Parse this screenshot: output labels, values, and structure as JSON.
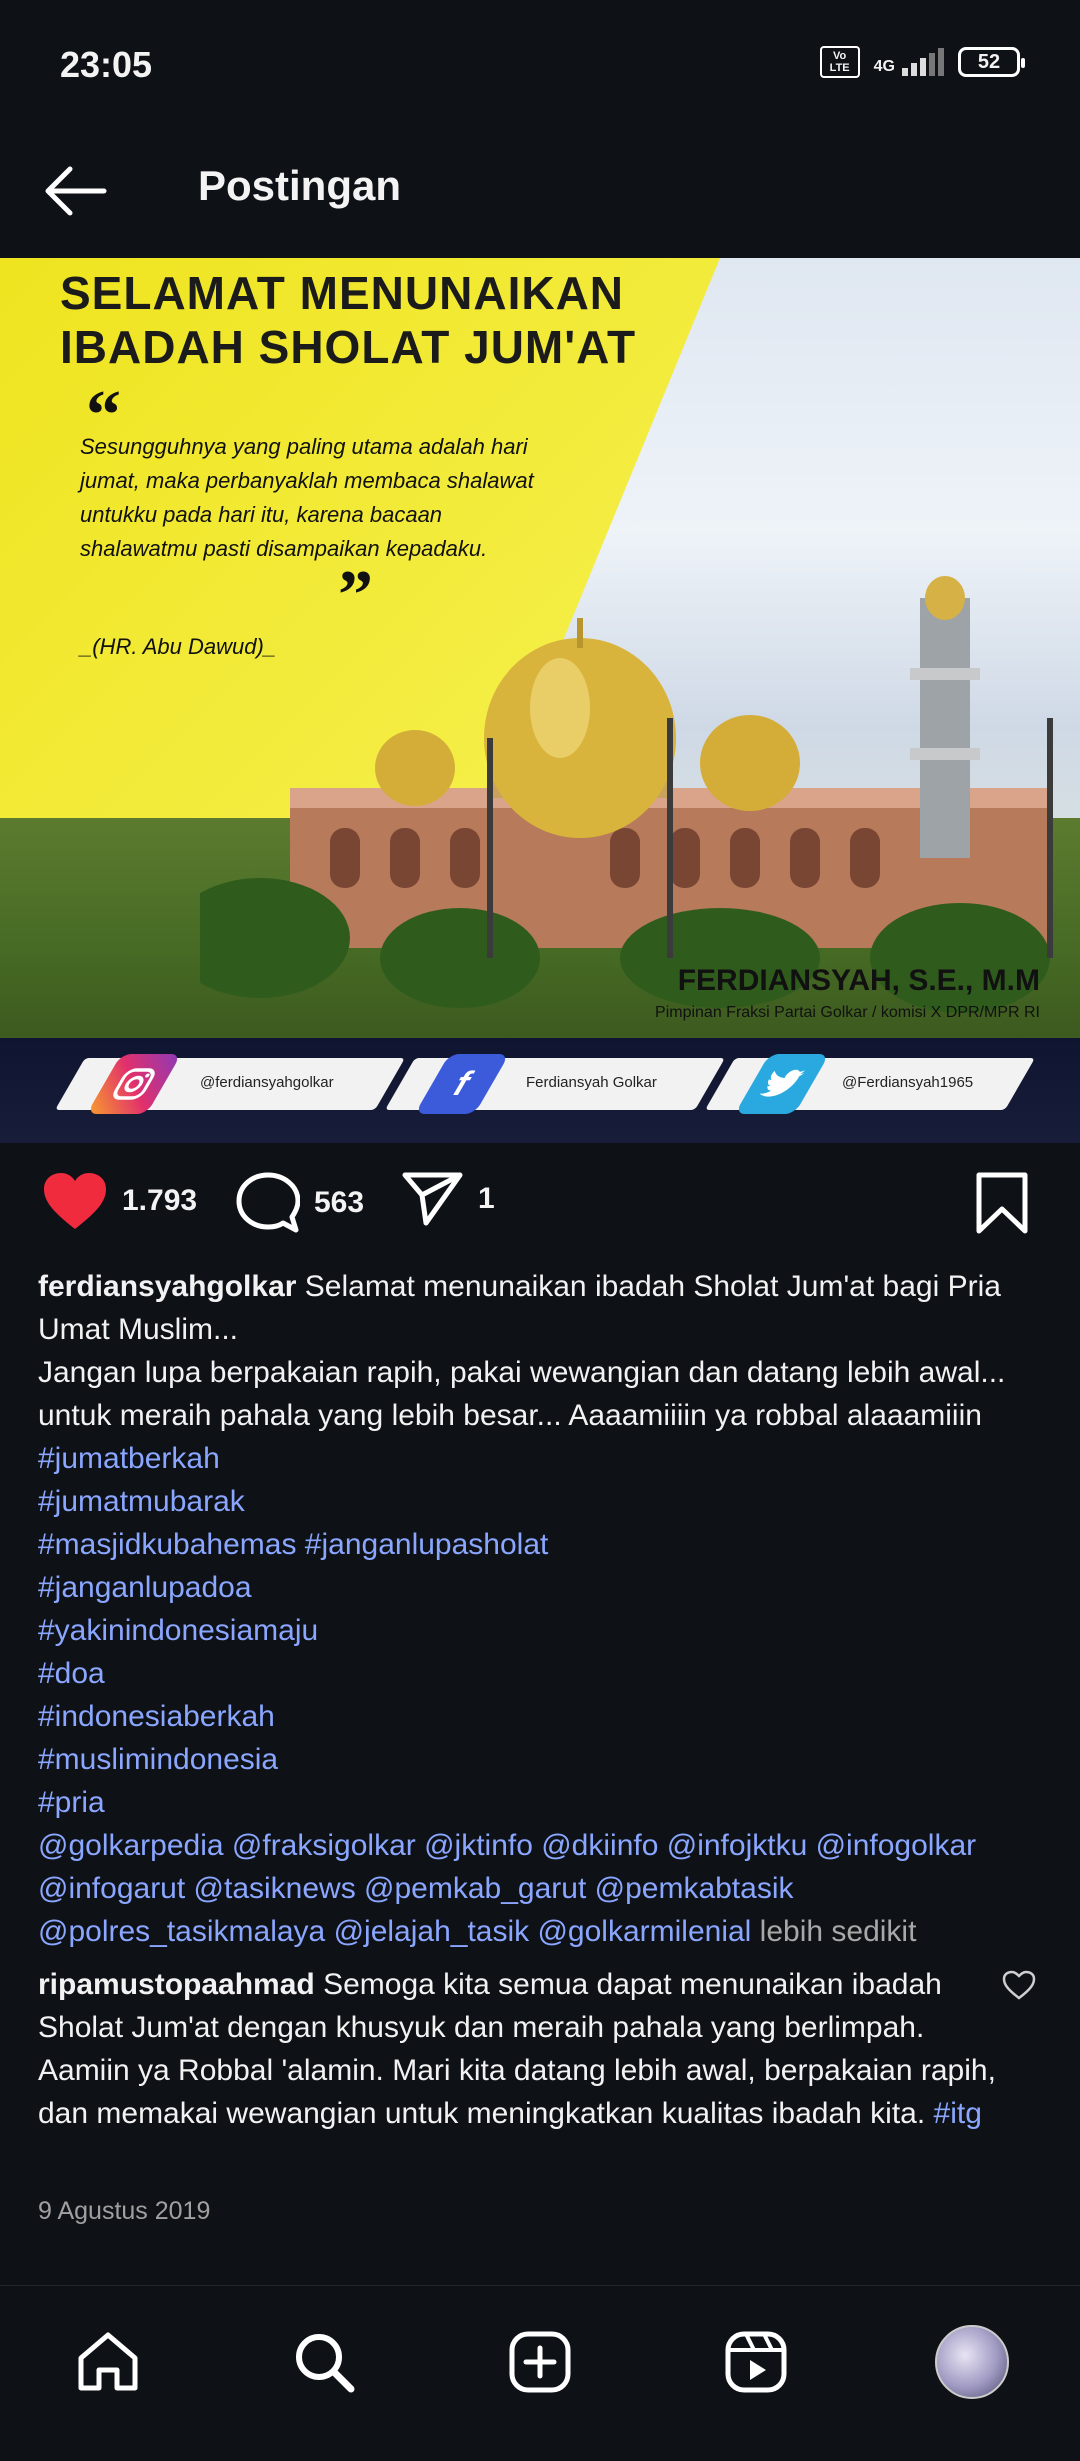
{
  "status_bar": {
    "time": "23:05",
    "volte": "Vo LTE",
    "network": "4G",
    "battery": "52"
  },
  "header": {
    "title": "Postingan"
  },
  "post_image": {
    "headline_line1": "SELAMAT MENUNAIKAN",
    "headline_line2": "IBADAH SHOLAT JUM'AT",
    "quote": "Sesungguhnya yang paling utama adalah hari jumat, maka perbanyaklah membaca shalawat untukku pada hari itu, karena bacaan shalawatmu pasti disampaikan kepadaku.",
    "quote_source": "_(HR. Abu Dawud)_",
    "signature_name": "FERDIANSYAH, S.E., M.M",
    "signature_sub": "Pimpinan Fraksi Partai Golkar / komisi X DPR/MPR RI",
    "instagram_handle": "@ferdiansyahgolkar",
    "facebook_handle": "Ferdiansyah Golkar",
    "twitter_handle": "@Ferdiansyah1965"
  },
  "actions": {
    "likes": "1.793",
    "comments": "563",
    "shares": "1"
  },
  "caption": {
    "username": "ferdiansyahgolkar",
    "text_1": " Selamat menunaikan ibadah Sholat Jum'at bagi Pria Umat Muslim...",
    "text_2": "Jangan lupa berpakaian rapih, pakai wewangian dan datang lebih awal... untuk meraih pahala yang lebih besar... Aaaamiiiin ya robbal alaaamiiin",
    "hashtags": [
      "#jumatberkah",
      "#jumatmubarak",
      "#masjidkubahemas #janganlupasholat",
      "#janganlupadoa",
      "#yakinindonesiamaju",
      "#doa",
      "#indonesiaberkah",
      "#muslimindonesia",
      "#pria"
    ],
    "mentions_1": "@golkarpedia @fraksigolkar @jktinfo @dkiinfo @infojktku @infogolkar",
    "mentions_2": "@infogarut @tasiknews @pemkab_garut @pemkabtasik",
    "mentions_3": "@polres_tasikmalaya @jelajah_tasik @golkarmilenial",
    "more": " lebih sedikit"
  },
  "comment": {
    "username": "ripamustopaahmad",
    "text": " Semoga kita semua dapat menunaikan ibadah Sholat Jum'at dengan khusyuk dan meraih pahala yang berlimpah. Aamiin ya Robbal 'alamin. Mari kita datang lebih awal, berpakaian rapih, dan memakai wewangian untuk meningkatkan kualitas ibadah kita. ",
    "tag": "#itg"
  },
  "post_date": "9 Agustus 2019",
  "colors": {
    "background": "#0e1116",
    "link": "#8aa6ff",
    "like": "#ef2b3d",
    "banner_yellow": "#efe41f"
  },
  "icons": [
    "back-arrow-icon",
    "heart-icon",
    "comment-icon",
    "share-icon",
    "bookmark-icon",
    "home-icon",
    "search-icon",
    "add-icon",
    "reels-icon"
  ]
}
